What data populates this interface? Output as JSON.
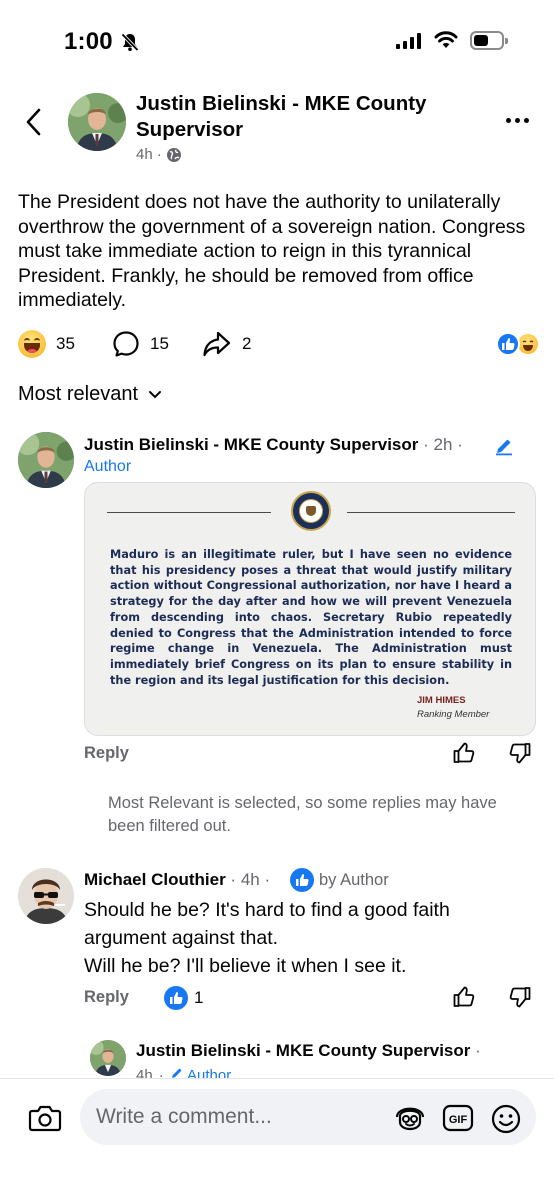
{
  "status_bar": {
    "time": "1:00"
  },
  "post": {
    "author": "Justin Bielinski - MKE County Supervisor",
    "age": "4h",
    "body": "The President does not have the authority to unilaterally overthrow the government of a sovereign nation. Congress must take immediate action to reign in this tyrannical President. Frankly, he should be removed from office immediately.",
    "reaction_count": "35",
    "comment_count": "15",
    "share_count": "2"
  },
  "sort": {
    "label": "Most relevant"
  },
  "comments": [
    {
      "author": "Justin Bielinski - MKE County Supervisor",
      "age": "2h",
      "author_tag": "Author",
      "image": {
        "quote": "Maduro is an illegitimate ruler, but I have seen no evidence that his presidency poses a threat that would justify military action without Congressional authorization, nor have I heard a strategy for the day after and how we will prevent Venezuela from descending into chaos. Secretary Rubio repeatedly denied to Congress that the Administration intended to force regime change in Venezuela. The Administration must immediately brief Congress on its plan to ensure stability in the region and its legal justification for this decision.",
        "signer_name": "JIM HIMES",
        "signer_title": "Ranking Member"
      },
      "reply_label": "Reply"
    },
    {
      "author": "Michael Clouthier",
      "age": "4h",
      "liked_by": "by Author",
      "text_line1": "Should he be? It's hard to find a good faith argument against that.",
      "text_line2": "Will he be? I'll believe it when I see it.",
      "reply_label": "Reply",
      "like_count": "1"
    }
  ],
  "filter_note": "Most Relevant is selected, so some replies may have been filtered out.",
  "nested_reply": {
    "author": "Justin Bielinski - MKE County Supervisor",
    "age": "4h",
    "author_tag": "Author"
  },
  "composer": {
    "placeholder": "Write a comment..."
  },
  "colors": {
    "accent": "#1877f2",
    "muted": "#65676b",
    "text": "#050505"
  },
  "icons": [
    "bell-off-icon",
    "signal-icon",
    "wifi-icon",
    "battery-icon",
    "back-icon",
    "globe-icon",
    "more-icon",
    "haha-icon",
    "comment-icon",
    "share-icon",
    "like-icon",
    "chevron-down-icon",
    "edit-icon",
    "thumbs-up-icon",
    "thumbs-down-icon",
    "camera-icon",
    "avatar-sticker-icon",
    "gif-icon",
    "smiley-icon"
  ]
}
